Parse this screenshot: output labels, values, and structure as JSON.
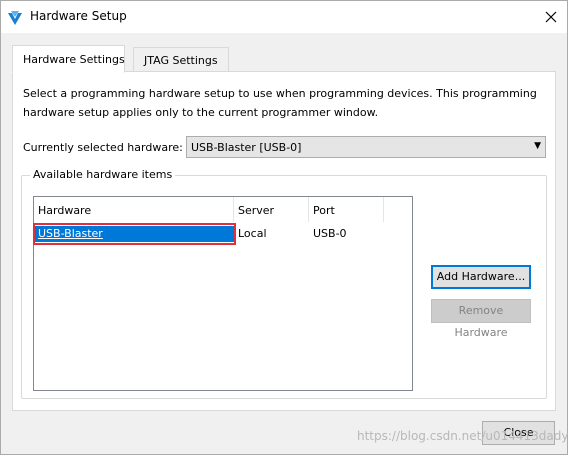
{
  "window": {
    "title": "Hardware Setup",
    "close_symbol": "✕"
  },
  "tabs": [
    {
      "label": "Hardware Settings",
      "selected": true
    },
    {
      "label": "JTAG Settings",
      "selected": false
    }
  ],
  "main": {
    "description": "Select a programming hardware setup to use when programming devices. This programming hardware setup applies only to the current programmer window.",
    "current_hardware_label": "Currently selected hardware:",
    "current_hardware_value": "USB-Blaster [USB-0]",
    "available_group_title": "Available hardware items",
    "table": {
      "columns": [
        "Hardware",
        "Server",
        "Port"
      ],
      "rows": [
        {
          "hardware": "USB-Blaster",
          "server": "Local",
          "port": "USB-0",
          "selected": true
        }
      ]
    },
    "buttons": {
      "add": "Add Hardware...",
      "remove": "Remove Hardware"
    }
  },
  "footer": {
    "close_label": "Close",
    "watermark": "https://blog.csdn.net/u014413dady"
  },
  "colors": {
    "selection": "#0078d7",
    "highlight_box": "#e0303a",
    "brand": "#1a7fd0"
  }
}
